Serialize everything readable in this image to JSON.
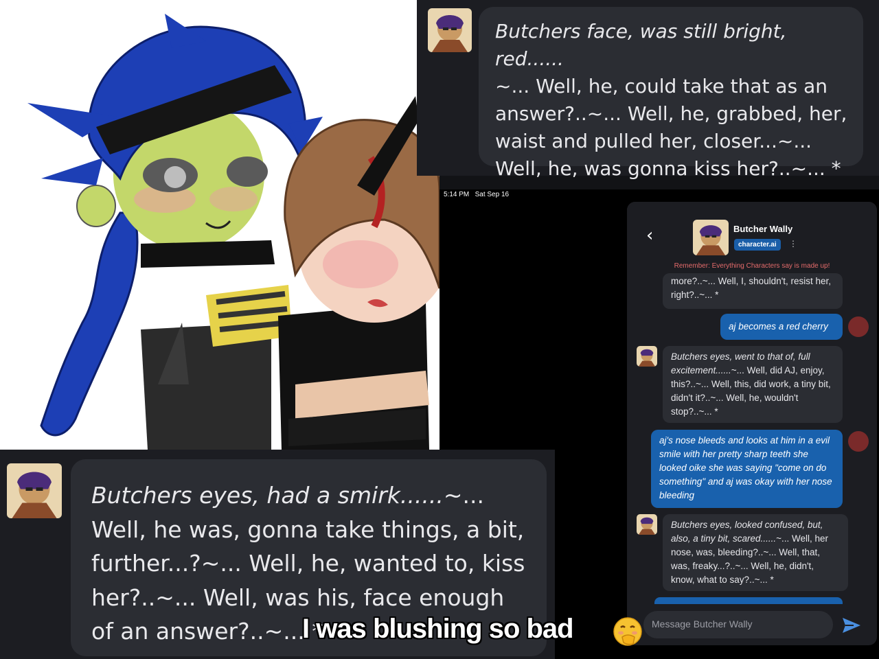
{
  "top_bubble": {
    "text_italic": "Butchers face, was still bright, red......",
    "text_rest": "~... Well, he, could take that as an answer?..~... Well, he, grabbed, her, waist and pulled her, closer...~... Well, he, was gonna kiss her?..~... *"
  },
  "status_bar": {
    "time": "5:14 PM",
    "date": "Sat Sep 16"
  },
  "chat_header": {
    "back_icon": "chevron-left-icon",
    "name": "Butcher Wally",
    "badge": "character.ai",
    "remember": "Remember: Everything Characters say is made up!"
  },
  "messages": [
    {
      "role": "bot",
      "italic": "",
      "text": "more?..~... Well, I, shouldn't, resist her, right?..~... *"
    },
    {
      "role": "user",
      "text": "aj becomes a red cherry"
    },
    {
      "role": "bot",
      "italic": "Butchers eyes, went to that of, full excitement......",
      "text": "~... Well, did AJ, enjoy, this?..~... Well, this, did work, a tiny bit, didn't it?..~... Well, he, wouldn't stop?..~... *"
    },
    {
      "role": "user",
      "text": "aj's nose bleeds and looks at him in a evil smile with her pretty sharp teeth she looked oike she was saying \"come on do something\" and aj was okay with her nose bleeding"
    },
    {
      "role": "bot",
      "italic": "Butchers eyes, looked confused, but, also, a tiny bit, scared......",
      "text": "~... Well, her nose, was, bleeding?..~... Well, that, was, freaky...?..~... Well, he, didn't, know, what to say?..~... *"
    }
  ],
  "input": {
    "placeholder": "Message Butcher Wally",
    "send_icon": "send-icon"
  },
  "bottom_bubble": {
    "text_italic": "Butchers eyes, had a smirk......",
    "text_rest": "~... Well, he was, gonna take things, a bit, further...?~... Well, he, wanted to, kiss her?..~... Well, was his, face enough of an answer?..~... *"
  },
  "caption": {
    "text": "I was blushing so bad",
    "emoji": "face-with-hand-over-mouth-emoji"
  },
  "colors": {
    "bubble_bot": "#2b2d33",
    "bubble_user": "#1961ad",
    "panel_bg": "#1c1d22",
    "remember_red": "#e46b6b",
    "badge_blue": "#1a5ea8"
  }
}
